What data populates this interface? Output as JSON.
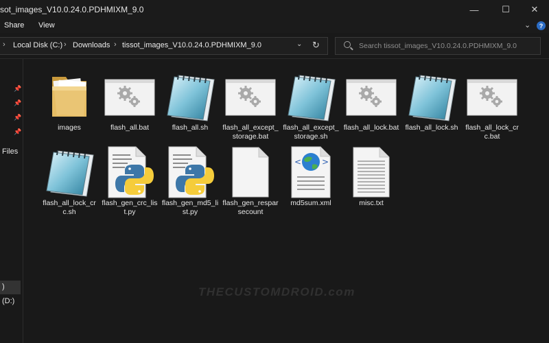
{
  "window": {
    "title": "sot_images_V10.0.24.0.PDHMIXM_9.0",
    "min_icon": "minimize-icon",
    "max_icon": "maximize-icon",
    "close_icon": "close-icon"
  },
  "ribbon": {
    "tabs": [
      "Share",
      "View"
    ],
    "help_label": "?"
  },
  "address": {
    "crumbs": [
      "Local Disk (C:)",
      "Downloads",
      "tissot_images_V10.0.24.0.PDHMIXM_9.0"
    ],
    "separator": "›"
  },
  "search": {
    "placeholder": "Search tissot_images_V10.0.24.0.PDHMIXM_9.0"
  },
  "nav": {
    "files_label": "Files",
    "item_1": ")",
    "item_2": "(D:)"
  },
  "files": [
    {
      "name": "images",
      "type": "folder"
    },
    {
      "name": "flash_all.bat",
      "type": "bat"
    },
    {
      "name": "flash_all.sh",
      "type": "sh"
    },
    {
      "name": "flash_all_except_storage.bat",
      "type": "bat"
    },
    {
      "name": "flash_all_except_storage.sh",
      "type": "sh"
    },
    {
      "name": "flash_all_lock.bat",
      "type": "bat"
    },
    {
      "name": "flash_all_lock.sh",
      "type": "sh"
    },
    {
      "name": "flash_all_lock_crc.bat",
      "type": "bat"
    },
    {
      "name": "flash_all_lock_crc.sh",
      "type": "sh"
    },
    {
      "name": "flash_gen_crc_list.py",
      "type": "py"
    },
    {
      "name": "flash_gen_md5_list.py",
      "type": "py"
    },
    {
      "name": "flash_gen_resparsecount",
      "type": "blank"
    },
    {
      "name": "md5sum.xml",
      "type": "xml"
    },
    {
      "name": "misc.txt",
      "type": "txt"
    }
  ],
  "watermark": "THECUSTOMDROID.com",
  "colors": {
    "background": "#191919",
    "folder": "#e8c068",
    "python_blue": "#3d77a8",
    "python_yellow": "#f5cc3b",
    "help_blue": "#2b6cc4"
  }
}
